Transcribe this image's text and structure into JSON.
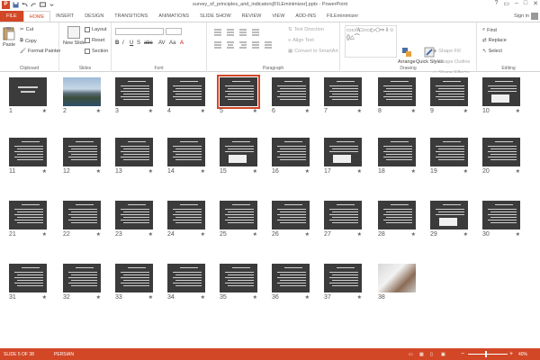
{
  "window": {
    "title": "survey_of_principles_and_indicators[FILEminimizer].pptx - PowerPoint",
    "controls": [
      "?",
      "▭",
      "–",
      "□",
      "✕"
    ]
  },
  "tabs": [
    "FILE",
    "HOME",
    "INSERT",
    "DESIGN",
    "TRANSITIONS",
    "ANIMATIONS",
    "SLIDE SHOW",
    "REVIEW",
    "VIEW",
    "ADD-INS",
    "FILEminimizer"
  ],
  "active_tab": "HOME",
  "sign_in": "Sign in",
  "ribbon": {
    "clipboard": {
      "label": "Clipboard",
      "paste": "Paste",
      "cut": "Cut",
      "copy": "Copy",
      "format_painter": "Format Painter"
    },
    "slides": {
      "label": "Slides",
      "new_slide": "New Slide",
      "layout": "Layout",
      "reset": "Reset",
      "section": "Section"
    },
    "font": {
      "label": "Font",
      "buttons": [
        "B",
        "I",
        "U",
        "S",
        "abc",
        "AV",
        "Aa",
        "A"
      ]
    },
    "paragraph": {
      "label": "Paragraph",
      "text_direction": "Text Direction",
      "align_text": "Align Text",
      "smartart": "Convert to SmartArt"
    },
    "drawing": {
      "label": "Drawing",
      "arrange": "Arrange",
      "quick_styles": "Quick Styles",
      "shape_fill": "Shape Fill",
      "shape_outline": "Shape Outline",
      "shape_effects": "Shape Effects",
      "shapes_glyphs": "▭▭\\\\□○▭▷⬠⇨⇩☆{}△⌒"
    },
    "editing": {
      "label": "Editing",
      "find": "Find",
      "replace": "Replace",
      "select": "Select"
    }
  },
  "slides": [
    {
      "n": "1",
      "star": "★",
      "kind": "title"
    },
    {
      "n": "2",
      "star": "★",
      "kind": "photo-mtn"
    },
    {
      "n": "3",
      "star": "★",
      "kind": "text"
    },
    {
      "n": "4",
      "star": "★",
      "kind": "text"
    },
    {
      "n": "5",
      "star": "★",
      "kind": "text",
      "selected": true
    },
    {
      "n": "6",
      "star": "★",
      "kind": "text"
    },
    {
      "n": "7",
      "star": "★",
      "kind": "text"
    },
    {
      "n": "8",
      "star": "★",
      "kind": "text"
    },
    {
      "n": "9",
      "star": "★",
      "kind": "text"
    },
    {
      "n": "10",
      "star": "★",
      "kind": "box"
    },
    {
      "n": "11",
      "star": "★",
      "kind": "text"
    },
    {
      "n": "12",
      "star": "★",
      "kind": "text"
    },
    {
      "n": "13",
      "star": "★",
      "kind": "text"
    },
    {
      "n": "14",
      "star": "★",
      "kind": "text"
    },
    {
      "n": "15",
      "star": "★",
      "kind": "box"
    },
    {
      "n": "16",
      "star": "★",
      "kind": "text"
    },
    {
      "n": "17",
      "star": "★",
      "kind": "box"
    },
    {
      "n": "18",
      "star": "★",
      "kind": "text"
    },
    {
      "n": "19",
      "star": "★",
      "kind": "text"
    },
    {
      "n": "20",
      "star": "★",
      "kind": "text"
    },
    {
      "n": "21",
      "star": "★",
      "kind": "text"
    },
    {
      "n": "22",
      "star": "★",
      "kind": "text"
    },
    {
      "n": "23",
      "star": "★",
      "kind": "text"
    },
    {
      "n": "24",
      "star": "★",
      "kind": "text"
    },
    {
      "n": "25",
      "star": "★",
      "kind": "text"
    },
    {
      "n": "26",
      "star": "★",
      "kind": "text"
    },
    {
      "n": "27",
      "star": "★",
      "kind": "text"
    },
    {
      "n": "28",
      "star": "★",
      "kind": "text"
    },
    {
      "n": "29",
      "star": "★",
      "kind": "box"
    },
    {
      "n": "30",
      "star": "★",
      "kind": "text"
    },
    {
      "n": "31",
      "star": "★",
      "kind": "text"
    },
    {
      "n": "32",
      "star": "★",
      "kind": "text"
    },
    {
      "n": "33",
      "star": "★",
      "kind": "text"
    },
    {
      "n": "34",
      "star": "★",
      "kind": "text"
    },
    {
      "n": "35",
      "star": "★",
      "kind": "text"
    },
    {
      "n": "36",
      "star": "★",
      "kind": "text"
    },
    {
      "n": "37",
      "star": "★",
      "kind": "text"
    },
    {
      "n": "38",
      "star": "",
      "kind": "photo-lap"
    }
  ],
  "status": {
    "slide_of": "SLIDE 5 OF 38",
    "language": "PERSIAN",
    "zoom": "40%",
    "zoom_minus": "−",
    "zoom_plus": "+"
  },
  "colors": {
    "accent": "#d24726",
    "thumb_bg": "#3b3b3b"
  }
}
